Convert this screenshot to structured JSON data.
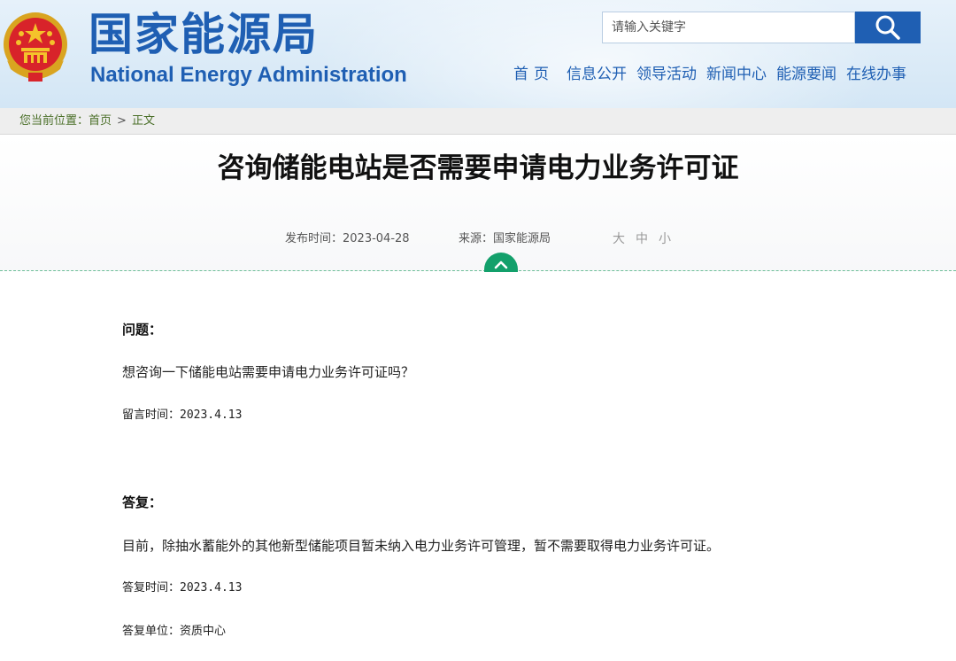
{
  "header": {
    "title_cn": "国家能源局",
    "title_en": "National Energy Administration",
    "emblem_icon": "national-emblem-icon",
    "brand_color": "#1f5fb3"
  },
  "search": {
    "placeholder": "请输入关键字",
    "icon": "search-icon"
  },
  "nav": {
    "items": [
      {
        "label": "首页"
      },
      {
        "label": "信息公开"
      },
      {
        "label": "领导活动"
      },
      {
        "label": "新闻中心"
      },
      {
        "label": "能源要闻"
      },
      {
        "label": "在线办事"
      }
    ]
  },
  "breadcrumb": {
    "prefix": "您当前位置：",
    "home": "首页",
    "separator": ">",
    "current": "正文"
  },
  "article": {
    "title": "咨询储能电站是否需要申请电力业务许可证",
    "publish_time": "发布时间：2023-04-28",
    "source": "来源：国家能源局",
    "font_sizes": [
      "大",
      "中",
      "小"
    ],
    "collapse_icon": "chevron-up-icon",
    "accent_color": "#13a06b"
  },
  "content": {
    "question_label": "问题：",
    "question_text": "想咨询一下储能电站需要申请电力业务许可证吗？",
    "question_time": "留言时间：2023.4.13",
    "answer_label": "答复：",
    "answer_text": "目前，除抽水蓄能外的其他新型储能项目暂未纳入电力业务许可管理，暂不需要取得电力业务许可证。",
    "answer_time": "答复时间：2023.4.13",
    "answer_unit": "答复单位：资质中心"
  }
}
